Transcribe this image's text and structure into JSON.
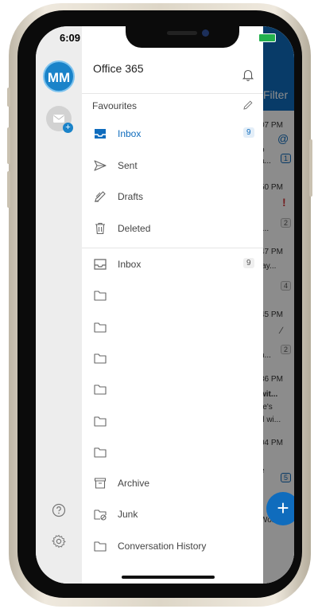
{
  "status": {
    "time": "6:09"
  },
  "account": {
    "initials": "MM",
    "name": "Office 365"
  },
  "favourites": {
    "label": "Favourites",
    "items": [
      {
        "label": "Inbox",
        "count": "9",
        "icon": "inbox-icon",
        "active": true
      },
      {
        "label": "Sent",
        "icon": "send-icon"
      },
      {
        "label": "Drafts",
        "icon": "pencil-icon"
      },
      {
        "label": "Deleted",
        "icon": "trash-icon"
      }
    ]
  },
  "folders": {
    "items": [
      {
        "label": "Inbox",
        "count": "9",
        "icon": "inbox-icon"
      },
      {
        "label": "",
        "icon": "folder-icon"
      },
      {
        "label": "",
        "icon": "folder-icon"
      },
      {
        "label": "",
        "icon": "folder-icon"
      },
      {
        "label": "",
        "icon": "folder-icon"
      },
      {
        "label": "",
        "icon": "folder-icon"
      },
      {
        "label": "",
        "icon": "folder-icon"
      },
      {
        "label": "Archive",
        "icon": "archive-icon"
      },
      {
        "label": "Junk",
        "icon": "junk-icon"
      },
      {
        "label": "Conversation History",
        "icon": "folder-icon"
      }
    ]
  },
  "background_list": {
    "filter_label": "Filter",
    "times": [
      "07 PM",
      "50 PM",
      "47 PM",
      "45 PM",
      "36 PM",
      "04 PM"
    ],
    "snippets": [
      "o",
      "a...",
      "r...",
      "lay...",
      "n...",
      "wit...",
      "re's",
      "d wi...",
      "e",
      "Wor..."
    ],
    "badges": [
      "1",
      "2",
      "4",
      "2",
      "5"
    ]
  },
  "colors": {
    "accent": "#0f6cbd",
    "rail": "#ededed"
  }
}
